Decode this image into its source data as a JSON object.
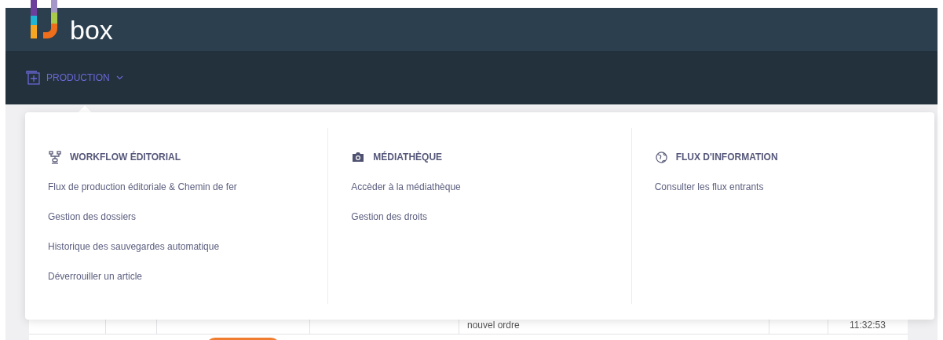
{
  "header": {
    "logo_text": "box"
  },
  "nav": {
    "items": [
      {
        "label": "PRODUCTION",
        "expanded": true
      }
    ]
  },
  "menu": {
    "columns": [
      {
        "kind": "workflow",
        "title": "WORKFLOW ÉDITORIAL",
        "links": [
          "Flux de production éditoriale & Chemin de fer",
          "Gestion des dossiers",
          "Historique des sauvegardes automatique",
          "Déverrouiller un article"
        ]
      },
      {
        "kind": "camera",
        "title": "MÉDIATHÈQUE",
        "links": [
          "Accèder à la médiathèque",
          "Gestion des droits"
        ]
      },
      {
        "kind": "globe",
        "title": "FLUX D'INFORMATION",
        "links": [
          "Consulter les flux entrants"
        ]
      }
    ]
  },
  "table": {
    "rows": [
      {
        "cells": [
          "nouvel ordre",
          "11:32:53"
        ]
      }
    ]
  }
}
